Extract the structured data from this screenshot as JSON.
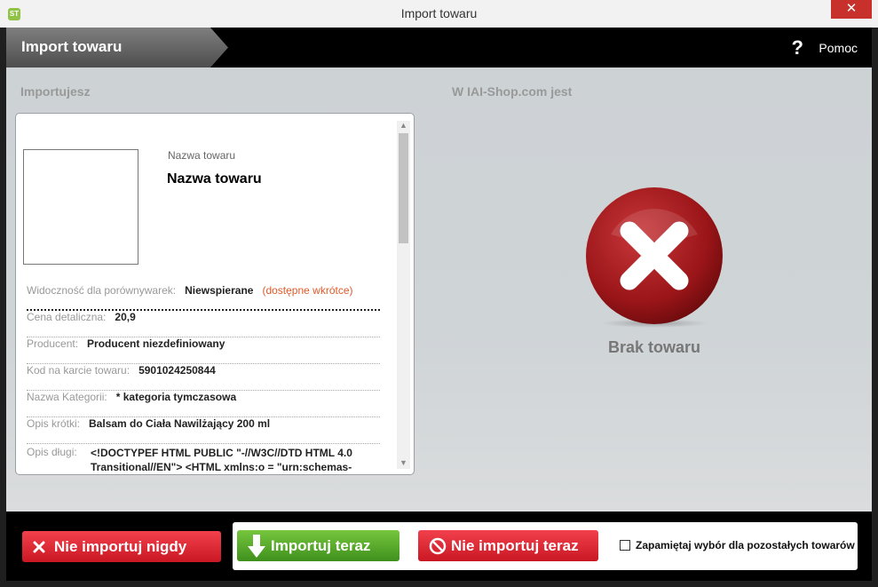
{
  "window": {
    "title": "Import towaru",
    "app_icon": "ST",
    "close_glyph": "✕"
  },
  "header": {
    "title": "Import towaru",
    "help_icon": "?",
    "help_label": "Pomoc"
  },
  "left": {
    "title": "Importujesz",
    "product": {
      "name_caption": "Nazwa towaru",
      "name": "Nazwa towaru",
      "rows": [
        {
          "label": "Widoczność dla porównywarek:",
          "value": "Niewspierane",
          "note": "(dostępne wkrótce)"
        },
        {
          "label": "Cena detaliczna:",
          "value": "20,9"
        },
        {
          "label": "Producent:",
          "value": "Producent niezdefiniowany"
        },
        {
          "label": "Kod na karcie towaru:",
          "value": "5901024250844"
        },
        {
          "label": "Nazwa Kategorii:",
          "value": "* kategoria tymczasowa"
        },
        {
          "label": "Opis krótki:",
          "value": "Balsam do Ciała Nawilżający 200 ml"
        }
      ],
      "long_desc": {
        "label": "Opis długi:",
        "value": "<!DOCTYPEF HTML PUBLIC \"-//W3C//DTD HTML 4.0 Transitional//EN\">  <HTML xmlns:o = \"urn:schemas-"
      }
    }
  },
  "right": {
    "title": "W IAI-Shop.com jest",
    "status": "Brak towaru",
    "icon": "close-icon"
  },
  "footer": {
    "never_label": "Nie importuj nigdy",
    "import_label": "Importuj teraz",
    "skip_label": "Nie importuj teraz",
    "remember_label": "Zapamiętaj wybór dla pozostałych towarów"
  },
  "colors": {
    "accent_red": "#c91824",
    "accent_green": "#3f901d",
    "note_orange": "#e05a2a"
  }
}
